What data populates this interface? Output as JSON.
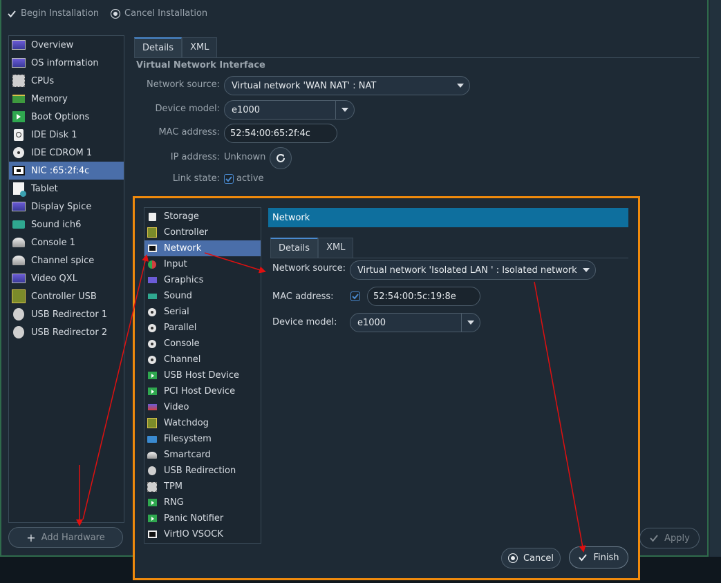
{
  "topbar": {
    "begin_label": "Begin Installation",
    "cancel_label": "Cancel Installation"
  },
  "device_list": [
    {
      "label": "Overview",
      "icon": "monitor-icon"
    },
    {
      "label": "OS information",
      "icon": "monitor-icon"
    },
    {
      "label": "CPUs",
      "icon": "chip-icon"
    },
    {
      "label": "Memory",
      "icon": "memory-icon"
    },
    {
      "label": "Boot Options",
      "icon": "boot-icon"
    },
    {
      "label": "IDE Disk 1",
      "icon": "disk-icon"
    },
    {
      "label": "IDE CDROM 1",
      "icon": "cdrom-icon"
    },
    {
      "label": "NIC :65:2f:4c",
      "icon": "nic-icon",
      "selected": true
    },
    {
      "label": "Tablet",
      "icon": "tablet-icon"
    },
    {
      "label": "Display Spice",
      "icon": "monitor-icon"
    },
    {
      "label": "Sound ich6",
      "icon": "sound-icon"
    },
    {
      "label": "Console 1",
      "icon": "console-icon"
    },
    {
      "label": "Channel spice",
      "icon": "console-icon"
    },
    {
      "label": "Video QXL",
      "icon": "monitor-icon"
    },
    {
      "label": "Controller USB",
      "icon": "controller-icon"
    },
    {
      "label": "USB Redirector 1",
      "icon": "usb-icon"
    },
    {
      "label": "USB Redirector 2",
      "icon": "usb-icon"
    }
  ],
  "add_hardware_label": "Add Hardware",
  "apply_label": "Apply",
  "details_panel": {
    "tabs": [
      "Details",
      "XML"
    ],
    "section_title": "Virtual Network Interface",
    "network_source_label": "Network source:",
    "network_source_value": "Virtual network 'WAN NAT' : NAT",
    "device_model_label": "Device model:",
    "device_model_value": "e1000",
    "mac_label": "MAC address:",
    "mac_value": "52:54:00:65:2f:4c",
    "ip_label": "IP address:",
    "ip_value": "Unknown",
    "link_label": "Link state:",
    "link_value": "active"
  },
  "add_hw_dialog": {
    "hardware_types": [
      {
        "label": "Storage",
        "icon": "storage-icon"
      },
      {
        "label": "Controller",
        "icon": "controller-icon"
      },
      {
        "label": "Network",
        "icon": "nic-icon",
        "selected": true
      },
      {
        "label": "Input",
        "icon": "input-icon"
      },
      {
        "label": "Graphics",
        "icon": "graphics-icon"
      },
      {
        "label": "Sound",
        "icon": "sound-icon"
      },
      {
        "label": "Serial",
        "icon": "serial-icon"
      },
      {
        "label": "Parallel",
        "icon": "serial-icon"
      },
      {
        "label": "Console",
        "icon": "serial-icon"
      },
      {
        "label": "Channel",
        "icon": "serial-icon"
      },
      {
        "label": "USB Host Device",
        "icon": "usb-host-icon"
      },
      {
        "label": "PCI Host Device",
        "icon": "usb-host-icon"
      },
      {
        "label": "Video",
        "icon": "video-icon"
      },
      {
        "label": "Watchdog",
        "icon": "controller-icon"
      },
      {
        "label": "Filesystem",
        "icon": "folder-icon"
      },
      {
        "label": "Smartcard",
        "icon": "smartcard-icon"
      },
      {
        "label": "USB Redirection",
        "icon": "usb-icon"
      },
      {
        "label": "TPM",
        "icon": "chip-icon"
      },
      {
        "label": "RNG",
        "icon": "usb-host-icon"
      },
      {
        "label": "Panic Notifier",
        "icon": "usb-host-icon"
      },
      {
        "label": "VirtIO VSOCK",
        "icon": "nic-icon"
      }
    ],
    "header": "Network",
    "tabs": [
      "Details",
      "XML"
    ],
    "network_source_label": "Network source:",
    "network_source_value": "Virtual network 'Isolated LAN ' : Isolated network",
    "mac_label": "MAC address:",
    "mac_value": "52:54:00:5c:19:8e",
    "mac_checked": true,
    "device_model_label": "Device model:",
    "device_model_value": "e1000",
    "cancel_label": "Cancel",
    "finish_label": "Finish"
  },
  "colors": {
    "highlight": "#f08a0c",
    "selection": "#4a6ea9",
    "header": "#0e6f9e",
    "annotation_arrow": "#e01010"
  }
}
